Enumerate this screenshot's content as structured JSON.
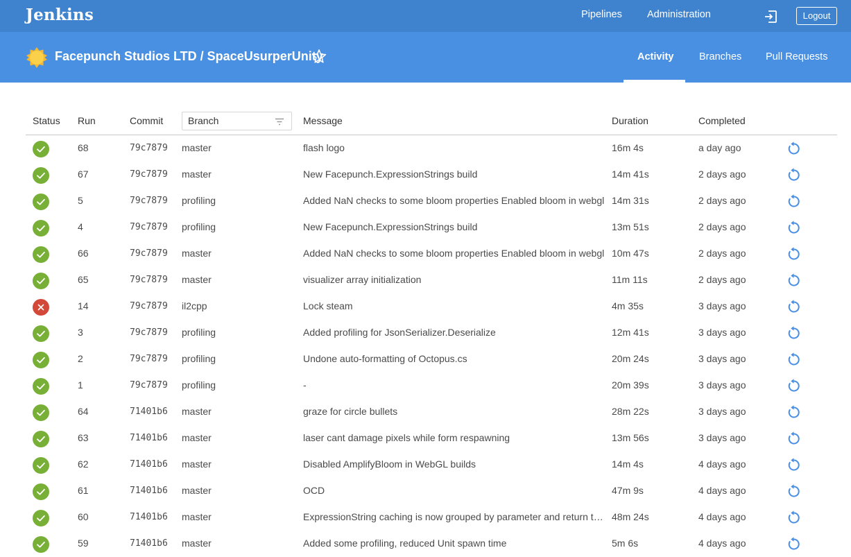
{
  "topbar": {
    "brand": "Jenkins",
    "nav": {
      "pipelines": "Pipelines",
      "administration": "Administration"
    },
    "logout_label": "Logout",
    "colors": {
      "topbar": "#3f83cf",
      "headbar": "#4a90e2",
      "success": "#78b037",
      "failure": "#d24939",
      "replay": "#4a90e2"
    }
  },
  "header": {
    "project_title": "Facepunch Studios LTD / SpaceUsurperUnity",
    "tabs": {
      "activity": "Activity",
      "branches": "Branches",
      "pull_requests": "Pull Requests"
    },
    "active_tab": "Activity"
  },
  "table": {
    "headers": {
      "status": "Status",
      "run": "Run",
      "commit": "Commit",
      "branch": "Branch",
      "message": "Message",
      "duration": "Duration",
      "completed": "Completed"
    },
    "rows": [
      {
        "status": "success",
        "run": "68",
        "commit": "79c7879",
        "branch": "master",
        "message": "flash logo",
        "duration": "16m 4s",
        "completed": "a day ago"
      },
      {
        "status": "success",
        "run": "67",
        "commit": "79c7879",
        "branch": "master",
        "message": "New Facepunch.ExpressionStrings build",
        "duration": "14m 41s",
        "completed": "2 days ago"
      },
      {
        "status": "success",
        "run": "5",
        "commit": "79c7879",
        "branch": "profiling",
        "message": "Added NaN checks to some bloom properties Enabled bloom in webgl",
        "duration": "14m 31s",
        "completed": "2 days ago"
      },
      {
        "status": "success",
        "run": "4",
        "commit": "79c7879",
        "branch": "profiling",
        "message": "New Facepunch.ExpressionStrings build",
        "duration": "13m 51s",
        "completed": "2 days ago"
      },
      {
        "status": "success",
        "run": "66",
        "commit": "79c7879",
        "branch": "master",
        "message": "Added NaN checks to some bloom properties Enabled bloom in webgl",
        "duration": "10m 47s",
        "completed": "2 days ago"
      },
      {
        "status": "success",
        "run": "65",
        "commit": "79c7879",
        "branch": "master",
        "message": "visualizer array initialization",
        "duration": "11m 11s",
        "completed": "2 days ago"
      },
      {
        "status": "failure",
        "run": "14",
        "commit": "79c7879",
        "branch": "il2cpp",
        "message": "Lock steam",
        "duration": "4m 35s",
        "completed": "3 days ago"
      },
      {
        "status": "success",
        "run": "3",
        "commit": "79c7879",
        "branch": "profiling",
        "message": "Added profiling for JsonSerializer.Deserialize",
        "duration": "12m 41s",
        "completed": "3 days ago"
      },
      {
        "status": "success",
        "run": "2",
        "commit": "79c7879",
        "branch": "profiling",
        "message": "Undone auto-formatting of Octopus.cs",
        "duration": "20m 24s",
        "completed": "3 days ago"
      },
      {
        "status": "success",
        "run": "1",
        "commit": "79c7879",
        "branch": "profiling",
        "message": "-",
        "duration": "20m 39s",
        "completed": "3 days ago"
      },
      {
        "status": "success",
        "run": "64",
        "commit": "71401b6",
        "branch": "master",
        "message": "graze for circle bullets",
        "duration": "28m 22s",
        "completed": "3 days ago"
      },
      {
        "status": "success",
        "run": "63",
        "commit": "71401b6",
        "branch": "master",
        "message": "laser cant damage pixels while form respawning",
        "duration": "13m 56s",
        "completed": "3 days ago"
      },
      {
        "status": "success",
        "run": "62",
        "commit": "71401b6",
        "branch": "master",
        "message": "Disabled AmplifyBloom in WebGL builds",
        "duration": "14m 4s",
        "completed": "4 days ago"
      },
      {
        "status": "success",
        "run": "61",
        "commit": "71401b6",
        "branch": "master",
        "message": "OCD",
        "duration": "47m 9s",
        "completed": "4 days ago"
      },
      {
        "status": "success",
        "run": "60",
        "commit": "71401b6",
        "branch": "master",
        "message": "ExpressionString caching is now grouped by parameter and return typ…",
        "duration": "48m 24s",
        "completed": "4 days ago"
      },
      {
        "status": "success",
        "run": "59",
        "commit": "71401b6",
        "branch": "master",
        "message": "Added some profiling, reduced Unit spawn time",
        "duration": "5m 6s",
        "completed": "4 days ago"
      }
    ]
  }
}
